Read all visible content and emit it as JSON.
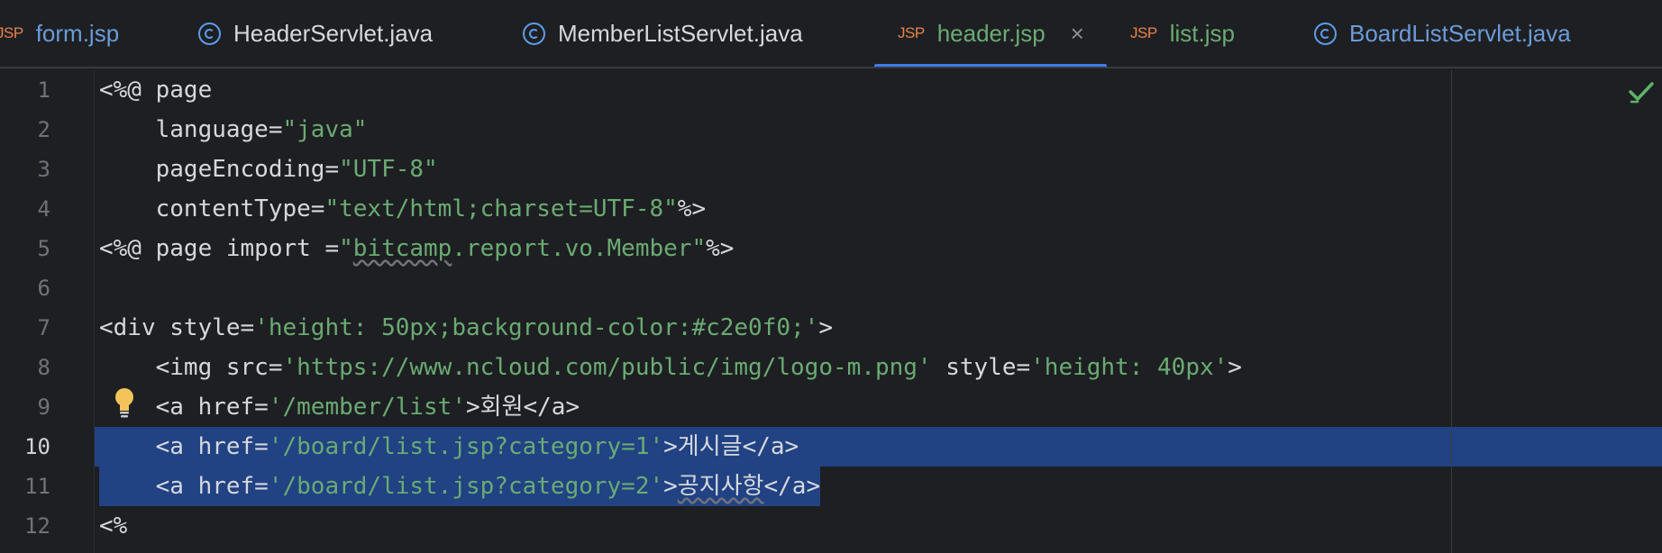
{
  "tabs": [
    {
      "label": "form.jsp",
      "kind": "jsp",
      "badge": "JSP",
      "color": "#6b9bd8"
    },
    {
      "label": "HeaderServlet.java",
      "kind": "class",
      "color": "#d5d8dd"
    },
    {
      "label": "MemberListServlet.java",
      "kind": "class",
      "color": "#d5d8dd"
    },
    {
      "label": "header.jsp",
      "kind": "jsp",
      "badge": "JSP",
      "color": "#6aab73",
      "active": true,
      "close": "×"
    },
    {
      "label": "list.jsp",
      "kind": "jsp",
      "badge": "JSP",
      "color": "#6aab73"
    },
    {
      "label": "BoardListServlet.java",
      "kind": "class",
      "color": "#6b9bd8"
    }
  ],
  "editor": {
    "current_line": 10,
    "line_numbers": [
      "1",
      "2",
      "3",
      "4",
      "5",
      "6",
      "7",
      "8",
      "9",
      "10",
      "11",
      "12"
    ],
    "lines": [
      [
        {
          "t": "<%@ page"
        }
      ],
      [
        {
          "t": "    language="
        },
        {
          "t": "\"java\"",
          "c": "str"
        }
      ],
      [
        {
          "t": "    pageEncoding="
        },
        {
          "t": "\"UTF-8\"",
          "c": "str"
        }
      ],
      [
        {
          "t": "    contentType="
        },
        {
          "t": "\"text/html;charset=UTF-8\"",
          "c": "str"
        },
        {
          "t": "%>"
        }
      ],
      [
        {
          "t": "<%@ page import ="
        },
        {
          "t": "\"",
          "c": "str"
        },
        {
          "t": "bitcamp",
          "c": "str wavy"
        },
        {
          "t": ".report.vo.Member\"",
          "c": "str"
        },
        {
          "t": "%>"
        }
      ],
      [],
      [
        {
          "t": "<div style="
        },
        {
          "t": "'height: 50px;background-color:#c2e0f0;'",
          "c": "str"
        },
        {
          "t": ">"
        }
      ],
      [
        {
          "t": "    <img src="
        },
        {
          "t": "'https://www.ncloud.com/public/img/logo-m.png'",
          "c": "str"
        },
        {
          "t": " style="
        },
        {
          "t": "'height: 40px'",
          "c": "str"
        },
        {
          "t": ">"
        }
      ],
      [
        {
          "t": "    <a href="
        },
        {
          "t": "'/member/list'",
          "c": "str"
        },
        {
          "t": ">"
        },
        {
          "t": "회원",
          "c": "ko"
        },
        {
          "t": "</a>"
        }
      ],
      [
        {
          "t": "    <a href="
        },
        {
          "t": "'/board/list.jsp?category=1'",
          "c": "str"
        },
        {
          "t": ">"
        },
        {
          "t": "게시글",
          "c": "ko"
        },
        {
          "t": "</a>"
        }
      ],
      [
        {
          "t": "    <a href="
        },
        {
          "t": "'/board/list.jsp?category=2'",
          "c": "str"
        },
        {
          "t": ">"
        },
        {
          "t": "공지사항",
          "c": "ko wavy"
        },
        {
          "t": "</a>"
        }
      ],
      [
        {
          "t": "<%"
        }
      ]
    ]
  }
}
